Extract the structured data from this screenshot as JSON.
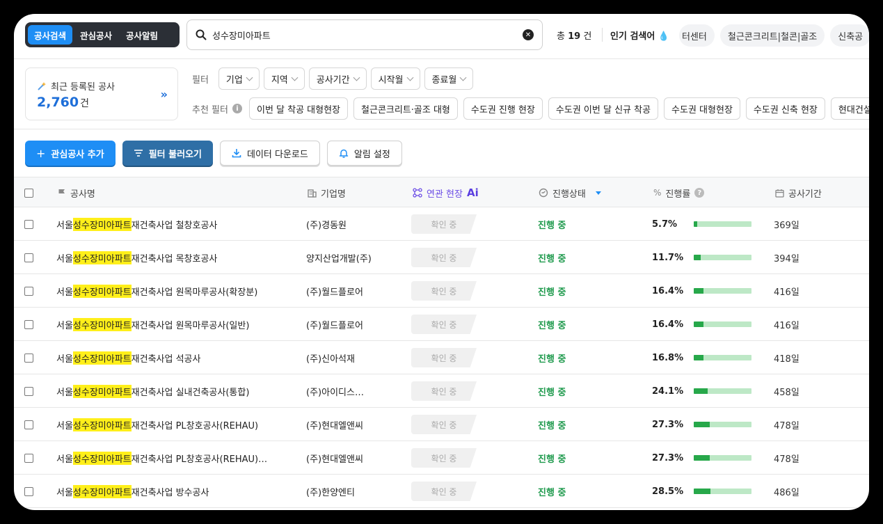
{
  "topbar": {
    "tabs": [
      "공사검색",
      "관심공사",
      "공사알림"
    ],
    "active_tab": 0,
    "search_value": "성수장미아파트",
    "total_prefix": "총",
    "total_count": "19",
    "total_unit": "건",
    "popular_label": "인기 검색어",
    "popular_chips": [
      "터센터",
      "철근콘크리트|철콘|골조",
      "신축공"
    ]
  },
  "stat": {
    "label": "최근 등록된 공사",
    "count": "2,760",
    "unit": "건"
  },
  "filters": {
    "title": "필터",
    "dropdowns": [
      "기업",
      "지역",
      "공사기간",
      "시작월",
      "종료월"
    ],
    "rec_title": "추천 필터",
    "rec_chips": [
      "이번 달 착공 대형현장",
      "철근콘크리트·골조 대형",
      "수도권 진행 현장",
      "수도권 이번 달 신규 착공",
      "수도권 대형현장",
      "수도권 신축 현장",
      "현대건설"
    ]
  },
  "actions": {
    "add": "관심공사 추가",
    "load": "필터 불러오기",
    "download": "데이터 다운로드",
    "alert": "알림 설정"
  },
  "table": {
    "headers": {
      "name": "공사명",
      "company": "기업명",
      "related": "연관 현장",
      "related_ai": "Ai",
      "status": "진행상태",
      "progress": "진행률",
      "period": "공사기간"
    },
    "rows": [
      {
        "pre": "서울 ",
        "hl": "성수장미아파트",
        "post": "재건축사업 철창호공사",
        "company": "(주)경동원",
        "related": "확인 중",
        "status": "진행 중",
        "pct": "5.7%",
        "pct_val": 5.7,
        "days": "369일"
      },
      {
        "pre": "서울 ",
        "hl": "성수장미아파트",
        "post": "재건축사업 목창호공사",
        "company": "양지산업개발(주)",
        "related": "확인 중",
        "status": "진행 중",
        "pct": "11.7%",
        "pct_val": 11.7,
        "days": "394일"
      },
      {
        "pre": "서울 ",
        "hl": "성수장미아파트",
        "post": "재건축사업 원목마루공사(확장분)",
        "company": "(주)월드플로어",
        "related": "확인 중",
        "status": "진행 중",
        "pct": "16.4%",
        "pct_val": 16.4,
        "days": "416일"
      },
      {
        "pre": "서울 ",
        "hl": "성수장미아파트",
        "post": "재건축사업 원목마루공사(일반)",
        "company": "(주)월드플로어",
        "related": "확인 중",
        "status": "진행 중",
        "pct": "16.4%",
        "pct_val": 16.4,
        "days": "416일"
      },
      {
        "pre": "서울 ",
        "hl": "성수장미아파트",
        "post": "재건축사업 석공사",
        "company": "(주)신아석재",
        "related": "확인 중",
        "status": "진행 중",
        "pct": "16.8%",
        "pct_val": 16.8,
        "days": "418일"
      },
      {
        "pre": "서울 ",
        "hl": "성수장미아파트",
        "post": "재건축사업 실내건축공사(통합)",
        "company": "(주)아이디스…",
        "related": "확인 중",
        "status": "진행 중",
        "pct": "24.1%",
        "pct_val": 24.1,
        "days": "458일"
      },
      {
        "pre": "서울 ",
        "hl": "성수장미아파트",
        "post": "재건축사업 PL창호공사(REHAU)",
        "company": "(주)현대엘앤씨",
        "related": "확인 중",
        "status": "진행 중",
        "pct": "27.3%",
        "pct_val": 27.3,
        "days": "478일"
      },
      {
        "pre": "서울 ",
        "hl": "성수장미아파트",
        "post": "재건축사업 PL창호공사(REHAU)…",
        "company": "(주)현대엘앤씨",
        "related": "확인 중",
        "status": "진행 중",
        "pct": "27.3%",
        "pct_val": 27.3,
        "days": "478일"
      },
      {
        "pre": "서울 ",
        "hl": "성수장미아파트",
        "post": "재건축사업 방수공사",
        "company": "(주)한양엔티",
        "related": "확인 중",
        "status": "진행 중",
        "pct": "28.5%",
        "pct_val": 28.5,
        "days": "486일"
      }
    ]
  },
  "colors": {
    "accent": "#1e8ef5",
    "status_green": "#1f9a4d",
    "highlight": "#ffef1a"
  }
}
